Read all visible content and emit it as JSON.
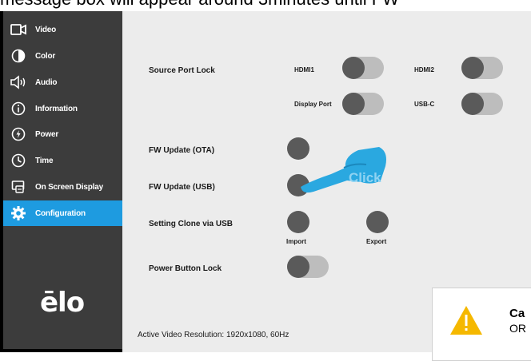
{
  "caption": "message box will appear around 3minutes until FW",
  "sidebar": {
    "items": [
      {
        "label": "Video",
        "icon": "video-camera-icon"
      },
      {
        "label": "Color",
        "icon": "contrast-icon"
      },
      {
        "label": "Audio",
        "icon": "speaker-icon"
      },
      {
        "label": "Information",
        "icon": "info-icon"
      },
      {
        "label": "Power",
        "icon": "power-icon"
      },
      {
        "label": "Time",
        "icon": "clock-icon"
      },
      {
        "label": "On Screen Display",
        "icon": "osd-icon"
      },
      {
        "label": "Configuration",
        "icon": "gear-icon"
      }
    ],
    "active": "Configuration",
    "logo": "ēlo"
  },
  "main": {
    "source_port_lock": {
      "label": "Source Port Lock",
      "ports": [
        "HDMI1",
        "HDMI2",
        "Display Port",
        "USB-C"
      ]
    },
    "fw_update_ota": "FW Update (OTA)",
    "fw_update_usb": "FW Update (USB)",
    "setting_clone": {
      "label": "Setting Clone via USB",
      "import": "Import",
      "export": "Export"
    },
    "power_button_lock": "Power Button Lock",
    "active_video_resolution": "Active Video Resolution:  1920x1080, 60Hz"
  },
  "overlay": {
    "click_text": "Click",
    "accent": "#2aa8e0"
  },
  "toast": {
    "title_partial": "Ca",
    "body_partial": "OR"
  },
  "colors": {
    "sidebar_bg": "#3c3c3c",
    "active_bg": "#1e9be0",
    "main_bg": "#ececec",
    "warning": "#f5b800"
  }
}
